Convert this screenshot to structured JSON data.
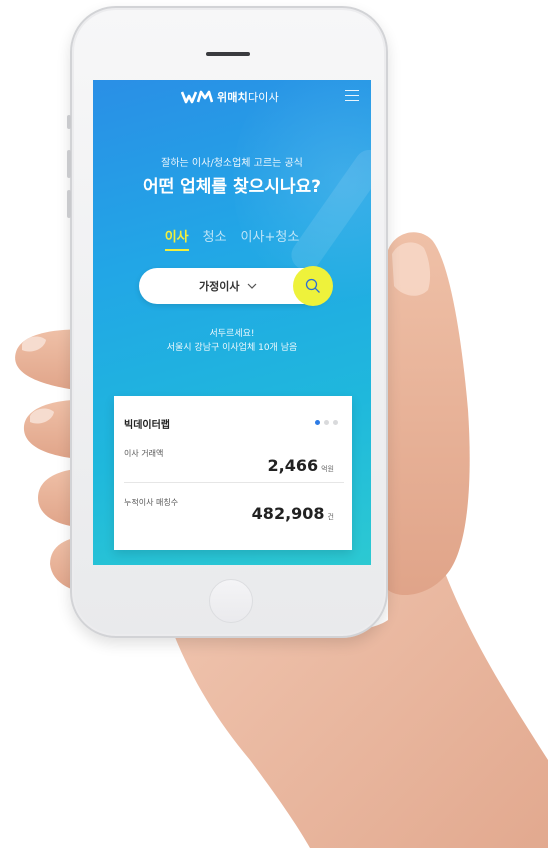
{
  "app": {
    "brand_bold": "위매치",
    "brand_light": "다이사"
  },
  "hero": {
    "subtitle": "잘하는 이사/청소업체 고르는 공식",
    "title": "어떤 업체를 찾으시나요?"
  },
  "tabs": [
    {
      "label": "이사",
      "active": true
    },
    {
      "label": "청소",
      "active": false
    },
    {
      "label": "이사+청소",
      "active": false
    }
  ],
  "search": {
    "selected_option": "가정이사"
  },
  "notice": {
    "line1": "서두르세요!",
    "line2": "서울시 강남구 이사업체 10개 남음"
  },
  "bigdata_card": {
    "title": "빅데이터랩",
    "pager": {
      "count": 3,
      "active_index": 0
    },
    "stats": [
      {
        "label": "이사 거래액",
        "value": "2,466",
        "unit": "억원"
      },
      {
        "label": "누적이사 매칭수",
        "value": "482,908",
        "unit": "건"
      }
    ]
  },
  "colors": {
    "screen_gradient_start": "#2a8fe6",
    "screen_gradient_end": "#2cc9d2",
    "accent_yellow": "#eef23b",
    "active_dot": "#2c7be5"
  },
  "icons": {
    "menu": "hamburger-icon",
    "search": "search-icon",
    "dropdown": "chevron-down-icon",
    "logo": "wm-logo-icon"
  }
}
